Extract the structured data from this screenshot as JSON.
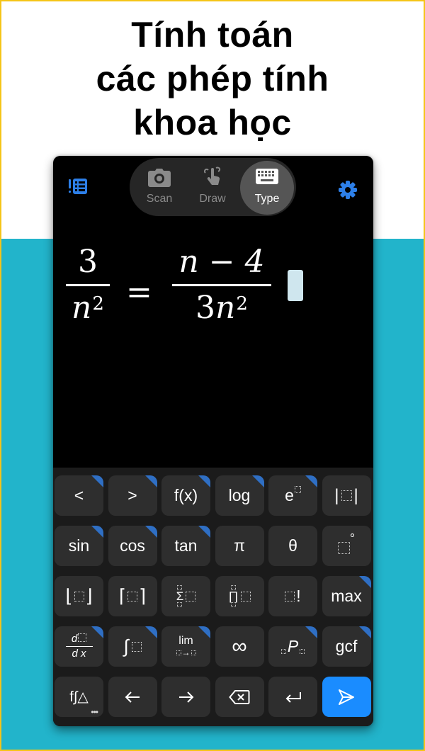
{
  "headline": {
    "lines": [
      "Tính toán",
      "các phép tính",
      "khoa học"
    ]
  },
  "colors": {
    "accent": "#1a8cff",
    "teal_background": "#22b4cb",
    "border": "#f5c518",
    "key_background": "#2e2e2e",
    "key_corner": "#2f6fc4",
    "cursor": "#cfe6ee"
  },
  "app": {
    "history_icon": "history-list-icon",
    "settings_icon": "gear-icon",
    "modes": [
      {
        "label": "Scan",
        "icon": "camera-icon",
        "active": false
      },
      {
        "label": "Draw",
        "icon": "hand-draw-icon",
        "active": false
      },
      {
        "label": "Type",
        "icon": "keyboard-icon",
        "active": true
      }
    ]
  },
  "expression": {
    "latex": "\\frac{3}{n^2}=\\frac{n-4}{3n^2}",
    "left_numerator": "3",
    "left_denominator_base": "n",
    "left_denominator_exp": "2",
    "equals": "=",
    "right_numerator": "n − 4",
    "right_denominator_coef": "3",
    "right_denominator_base": "n",
    "right_denominator_exp": "2"
  },
  "keyboard": {
    "rows": [
      [
        {
          "label": "<",
          "name": "less-than",
          "has_more": true
        },
        {
          "label": ">",
          "name": "greater-than",
          "has_more": true
        },
        {
          "label": "f(x)",
          "name": "function",
          "has_more": true
        },
        {
          "label": "log",
          "name": "log",
          "has_more": true
        },
        {
          "label": "e",
          "name": "exponential",
          "has_more": true
        },
        {
          "label": "|□|",
          "name": "absolute-value",
          "has_more": false
        }
      ],
      [
        {
          "label": "sin",
          "name": "sin",
          "has_more": true
        },
        {
          "label": "cos",
          "name": "cos",
          "has_more": true
        },
        {
          "label": "tan",
          "name": "tan",
          "has_more": true
        },
        {
          "label": "π",
          "name": "pi",
          "has_more": false
        },
        {
          "label": "θ",
          "name": "theta",
          "has_more": false
        },
        {
          "label": "°",
          "name": "degree",
          "has_more": false
        }
      ],
      [
        {
          "label": "⌊□⌋",
          "name": "floor",
          "has_more": false
        },
        {
          "label": "⌈□⌉",
          "name": "ceiling",
          "has_more": false
        },
        {
          "label": "Σ",
          "name": "summation",
          "has_more": false
        },
        {
          "label": "∏",
          "name": "product",
          "has_more": false
        },
        {
          "label": "!",
          "name": "factorial",
          "has_more": false
        },
        {
          "label": "max",
          "name": "max",
          "has_more": true
        }
      ],
      [
        {
          "label": "d/dx",
          "name": "derivative",
          "has_more": true
        },
        {
          "label": "∫",
          "name": "integral",
          "has_more": true
        },
        {
          "label": "lim",
          "name": "limit",
          "has_more": true
        },
        {
          "label": "∞",
          "name": "infinity",
          "has_more": false
        },
        {
          "label": "P",
          "name": "permutation",
          "has_more": true
        },
        {
          "label": "gcf",
          "name": "gcf",
          "has_more": true
        }
      ],
      [
        {
          "label": "f∫△",
          "name": "more-functions",
          "has_more": false
        },
        {
          "label": "←",
          "name": "cursor-left",
          "has_more": false
        },
        {
          "label": "→",
          "name": "cursor-right",
          "has_more": false
        },
        {
          "label": "⌫",
          "name": "backspace",
          "has_more": false
        },
        {
          "label": "↵",
          "name": "new-line",
          "has_more": false
        },
        {
          "label": "➤",
          "name": "send",
          "has_more": false
        }
      ]
    ],
    "derivative_top": "d",
    "derivative_bottom": "d x",
    "limit_label": "lim",
    "limit_arrow": "→",
    "more_dots": "•••"
  }
}
